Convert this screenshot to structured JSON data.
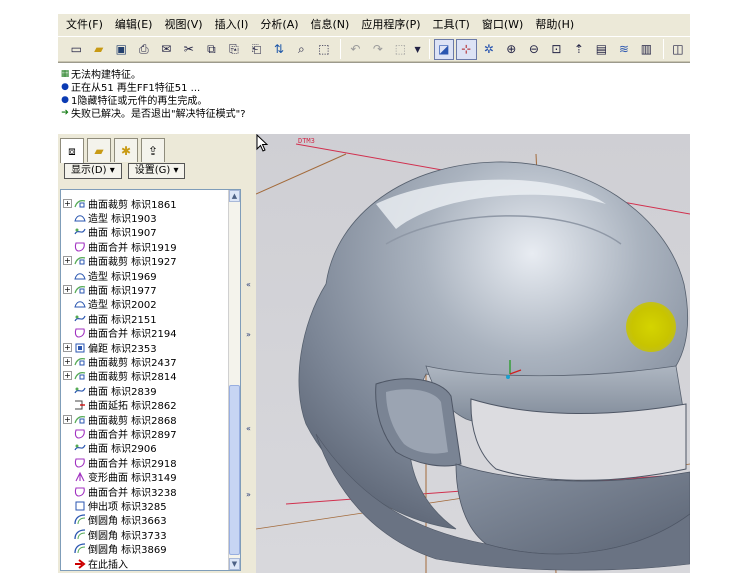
{
  "menubar": {
    "items": [
      "文件(F)",
      "编辑(E)",
      "视图(V)",
      "插入(I)",
      "分析(A)",
      "信息(N)",
      "应用程序(P)",
      "工具(T)",
      "窗口(W)",
      "帮助(H)"
    ]
  },
  "toolbar": {
    "icons": [
      "new-file-icon",
      "open-folder-icon",
      "save-icon",
      "print-icon",
      "send-mail-icon",
      "cut-icon",
      "copy-icon",
      "paste-icon",
      "paste-special-icon",
      "regenerate-icon",
      "find-icon",
      "selection-filter-icon",
      "undo-icon",
      "redo-icon",
      "repaint-icon",
      "spin-center-icon",
      "orient-icon",
      "zoom-in-icon",
      "zoom-out-icon",
      "refit-icon",
      "reorient-icon",
      "saved-views-icon",
      "layers-icon",
      "model-tree-icon",
      "hidden-line-icon"
    ]
  },
  "messages": [
    {
      "icon": "warning-icon",
      "text": "无法构建特征。"
    },
    {
      "icon": "info-bullet-icon",
      "text": "正在从51 再生FF1特征51 ..."
    },
    {
      "icon": "info-bullet-icon",
      "text": "1隐藏特征或元件的再生完成。"
    },
    {
      "icon": "prompt-arrow-icon",
      "text": "失败已解决。是否退出\"解决特征模式\"?"
    }
  ],
  "left_panel": {
    "show_button": "显示(D)",
    "settings_button": "设置(G)",
    "tree_items": [
      {
        "expander": "+",
        "icon": "trim-icon",
        "label": "曲面裁剪 标识1861"
      },
      {
        "expander": "",
        "icon": "style-icon",
        "label": "造型 标识1903"
      },
      {
        "expander": "",
        "icon": "surface-icon",
        "label": "曲面 标识1907"
      },
      {
        "expander": "",
        "icon": "merge-icon",
        "label": "曲面合并 标识1919"
      },
      {
        "expander": "+",
        "icon": "trim-icon",
        "label": "曲面裁剪 标识1927"
      },
      {
        "expander": "",
        "icon": "style-icon",
        "label": "造型 标识1969"
      },
      {
        "expander": "+",
        "icon": "trim-icon",
        "label": "曲面 标识1977"
      },
      {
        "expander": "",
        "icon": "style-icon",
        "label": "造型 标识2002"
      },
      {
        "expander": "",
        "icon": "surface-icon",
        "label": "曲面 标识2151"
      },
      {
        "expander": "",
        "icon": "merge-icon",
        "label": "曲面合并 标识2194"
      },
      {
        "expander": "+",
        "icon": "offset-icon",
        "label": "偏距 标识2353"
      },
      {
        "expander": "+",
        "icon": "trim-icon",
        "label": "曲面裁剪 标识2437"
      },
      {
        "expander": "+",
        "icon": "trim-icon",
        "label": "曲面裁剪 标识2814"
      },
      {
        "expander": "",
        "icon": "surface-icon",
        "label": "曲面 标识2839"
      },
      {
        "expander": "",
        "icon": "extend-icon",
        "label": "曲面延拓 标识2862"
      },
      {
        "expander": "+",
        "icon": "trim-icon",
        "label": "曲面裁剪 标识2868"
      },
      {
        "expander": "",
        "icon": "merge-icon",
        "label": "曲面合并 标识2897"
      },
      {
        "expander": "",
        "icon": "surface-icon",
        "label": "曲面 标识2906"
      },
      {
        "expander": "",
        "icon": "merge-icon",
        "label": "曲面合并 标识2918"
      },
      {
        "expander": "",
        "icon": "warp-icon",
        "label": "变形曲面 标识3149"
      },
      {
        "expander": "",
        "icon": "merge-icon",
        "label": "曲面合并 标识3238"
      },
      {
        "expander": "",
        "icon": "protrusion-icon",
        "label": "伸出项 标识3285"
      },
      {
        "expander": "",
        "icon": "round-icon",
        "label": "倒圆角 标识3663"
      },
      {
        "expander": "",
        "icon": "round-icon",
        "label": "倒圆角 标识3733"
      },
      {
        "expander": "",
        "icon": "round-icon",
        "label": "倒圆角 标识3869"
      },
      {
        "expander": "",
        "icon": "insert-here-icon",
        "label": "在此插入"
      }
    ]
  },
  "viewport": {
    "datum_label": "DTM3",
    "colors": {
      "background": "#d2d2d6",
      "helmet": "#7f8a99",
      "datum_plane": "#d1304e",
      "datum_axis": "#a36a3a",
      "highlight": "#c8c400"
    }
  }
}
